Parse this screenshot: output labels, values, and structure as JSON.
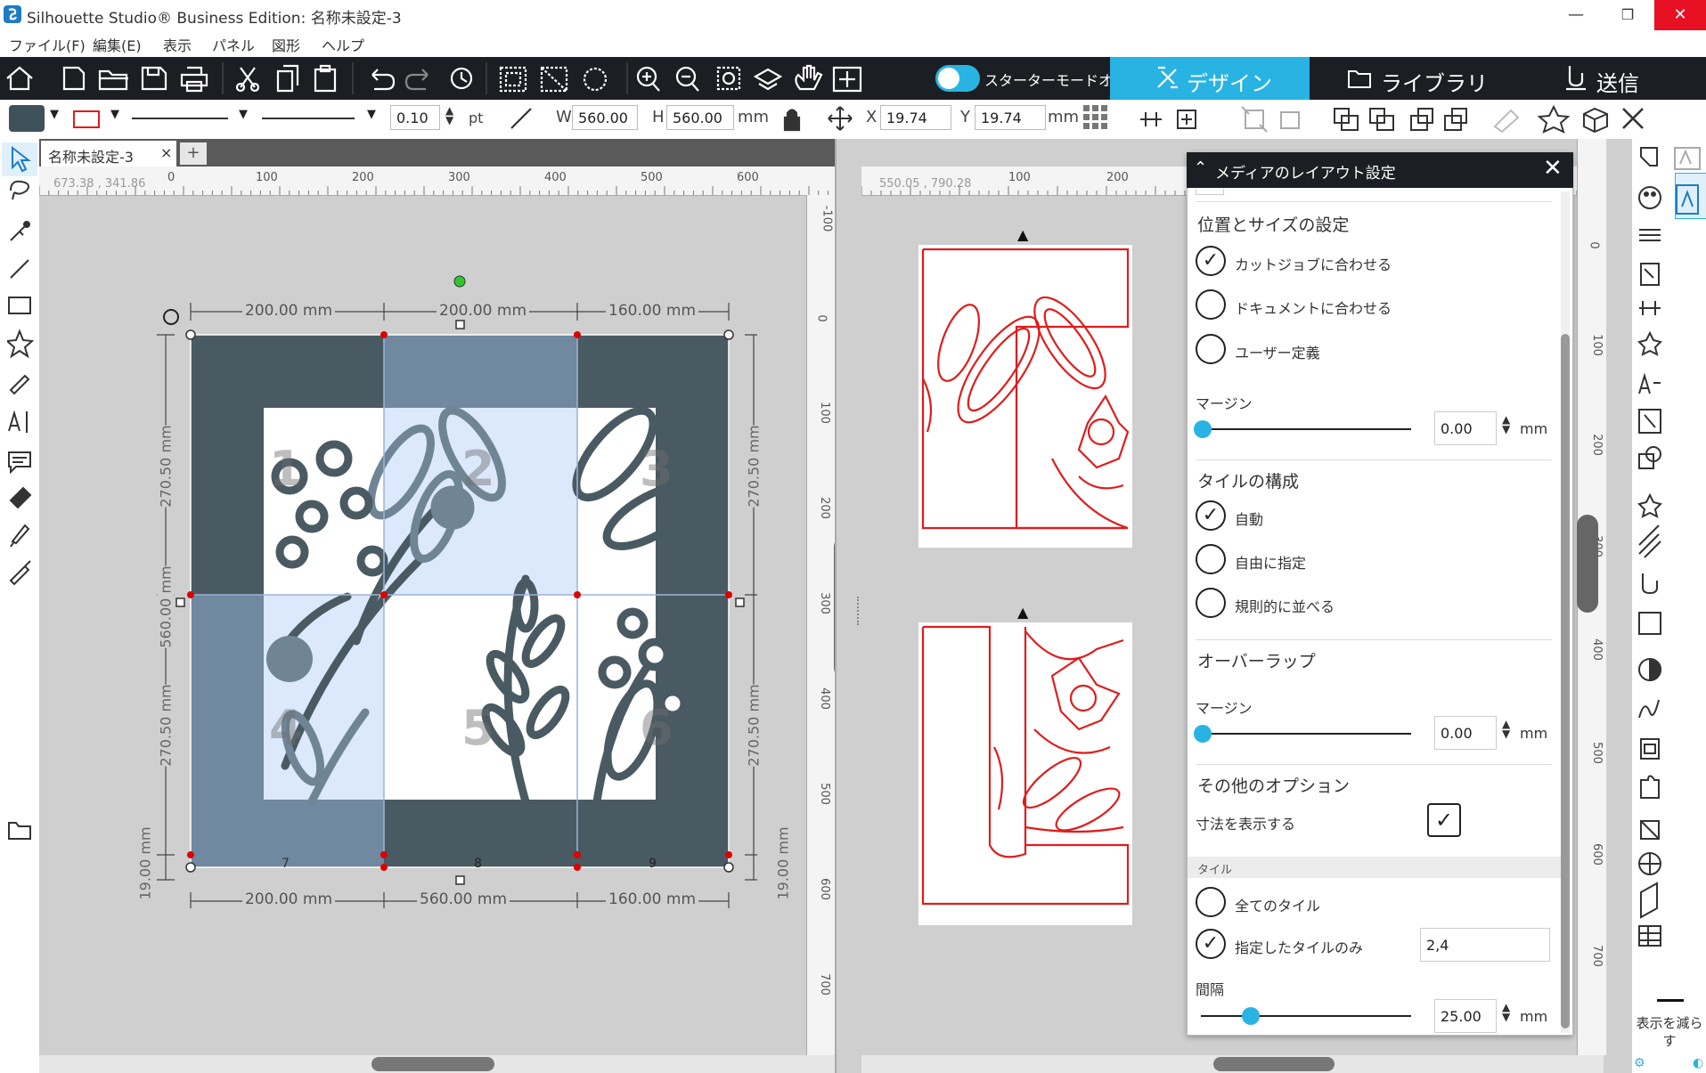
{
  "window": {
    "title": "Silhouette Studio® Business Edition: 名称未設定-3",
    "minimize": "—",
    "restore": "❐",
    "close": "✕"
  },
  "menu": {
    "items": [
      "ファイル(F)",
      "編集(E)",
      "表示",
      "パネル",
      "図形",
      "ヘルプ"
    ]
  },
  "toolbar": {
    "starter_mode_label": "スターターモードオフ",
    "tabs": [
      {
        "label": "デザイン",
        "active": true
      },
      {
        "label": "ライブラリ"
      },
      {
        "label": "送信"
      }
    ]
  },
  "properties": {
    "line_width": "0.10",
    "line_unit": "pt",
    "w_label": "W",
    "w_value": "560.00",
    "h_label": "H",
    "h_value": "560.00",
    "size_unit": "mm",
    "x_label": "X",
    "x_value": "19.74",
    "y_label": "Y",
    "y_value": "19.74",
    "pos_unit": "mm",
    "fill_color": "#3f515a",
    "line_color": "#e01c1c"
  },
  "document": {
    "tab_label": "名称未設定-3",
    "tab_close": "×",
    "add_tab": "+"
  },
  "canvas_left": {
    "cursor_coords": "673.38 , 341.86",
    "ruler_ticks": [
      "0",
      "100",
      "200",
      "300",
      "400",
      "500",
      "600"
    ],
    "vruler_ticks": [
      "-100",
      "0",
      "100",
      "200",
      "300",
      "400",
      "500",
      "600",
      "700"
    ],
    "dims_top": [
      "200.00 mm",
      "200.00 mm",
      "160.00 mm"
    ],
    "dims_bottom": [
      "200.00 mm",
      "560.00 mm",
      "160.00 mm"
    ],
    "dims_left": [
      "270.50 mm",
      "560.00 mm",
      "270.50 mm"
    ],
    "dims_right": [
      "270.50 mm",
      "270.50 mm"
    ],
    "margin_left": "19.00 mm",
    "margin_right": "19.00 mm",
    "tile_numbers": [
      "1",
      "2",
      "3",
      "4",
      "5",
      "6",
      "7",
      "8",
      "9"
    ]
  },
  "canvas_right": {
    "cursor_coords": "550.05 , 790.28",
    "ruler_ticks": [
      "100",
      "200"
    ],
    "vruler_ticks": [
      "0",
      "100",
      "200",
      "300",
      "400",
      "500",
      "600",
      "700"
    ]
  },
  "panel": {
    "title": "メディアのレイアウト設定",
    "position_size": {
      "title": "位置とサイズの設定",
      "options": [
        {
          "label": "カットジョブに合わせる",
          "checked": true
        },
        {
          "label": "ドキュメントに合わせる",
          "checked": false
        },
        {
          "label": "ユーザー定義",
          "checked": false
        }
      ],
      "margin_label": "マージン",
      "margin_value": "0.00",
      "margin_unit": "mm",
      "margin_level": 0
    },
    "tile_config": {
      "title": "タイルの構成",
      "options": [
        {
          "label": "自動",
          "checked": true
        },
        {
          "label": "自由に指定",
          "checked": false
        },
        {
          "label": "規則的に並べる",
          "checked": false
        }
      ]
    },
    "overlap": {
      "title": "オーバーラップ",
      "margin_label": "マージン",
      "margin_value": "0.00",
      "margin_unit": "mm",
      "margin_level": 0
    },
    "other": {
      "title": "その他のオプション",
      "show_dims_label": "寸法を表示する",
      "show_dims_checked": true
    },
    "tiles": {
      "band_label": "タイル",
      "options": [
        {
          "label": "全てのタイル",
          "checked": false
        },
        {
          "label": "指定したタイルのみ",
          "checked": true
        }
      ],
      "selected_tiles_value": "2,4",
      "spacing_label": "間隔",
      "spacing_value": "25.00",
      "spacing_unit": "mm"
    }
  },
  "right_strip": {
    "reduce_label": "表示を減らす"
  },
  "colors": {
    "accent": "#29b3e3",
    "toolbar_bg": "#1b1e22",
    "tile_dark": "#4a5a62",
    "tile_light": "#7088a0",
    "cut_red": "#e01c1c"
  }
}
